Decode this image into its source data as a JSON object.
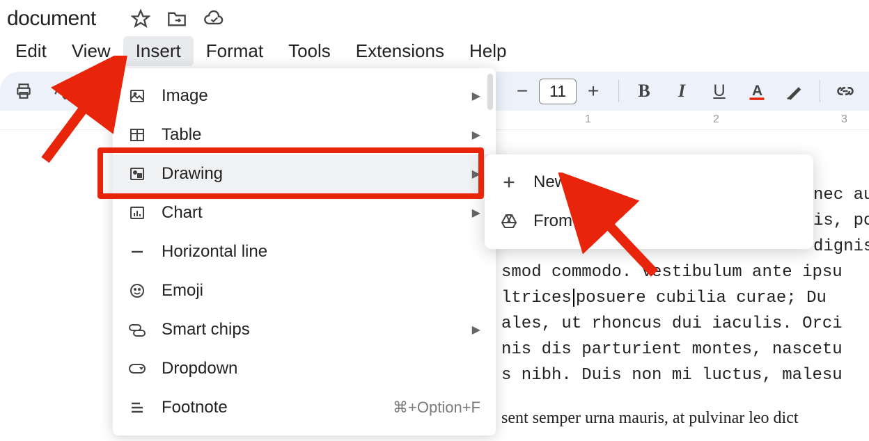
{
  "title": "document",
  "menubar": [
    "Edit",
    "View",
    "Insert",
    "Format",
    "Tools",
    "Extensions",
    "Help"
  ],
  "menubar_open_index": 2,
  "font_size": "11",
  "insert_menu": [
    {
      "icon": "image",
      "label": "Image",
      "submenu": true
    },
    {
      "icon": "table",
      "label": "Table",
      "submenu": true
    },
    {
      "icon": "drawing",
      "label": "Drawing",
      "submenu": true,
      "hovered": true
    },
    {
      "icon": "chart",
      "label": "Chart",
      "submenu": true
    },
    {
      "icon": "hr",
      "label": "Horizontal line"
    },
    {
      "icon": "emoji",
      "label": "Emoji"
    },
    {
      "icon": "chips",
      "label": "Smart chips",
      "submenu": true
    },
    {
      "icon": "dropdown",
      "label": "Dropdown"
    },
    {
      "icon": "footnote",
      "label": "Footnote",
      "shortcut": "⌘+Option+F"
    }
  ],
  "drawing_submenu": [
    {
      "icon": "plus",
      "label": "New"
    },
    {
      "icon": "drive",
      "label": "From Drive"
    }
  ],
  "ruler_numbers": [
    "1",
    "2",
    "3"
  ],
  "doc_lines_mono": [
    "nec au",
    "is, po",
    "dignis",
    "smod commodo. Vestibulum ante ipsu",
    "ltrices| posuere cubilia curae; Du",
    "ales, ut rhoncus dui iaculis. Orci",
    "nis dis parturient montes, nascetu",
    "s nibh. Duis non mi luctus, malesu"
  ],
  "doc_lines_serif": "sent semper urna mauris, at pulvinar leo dict"
}
